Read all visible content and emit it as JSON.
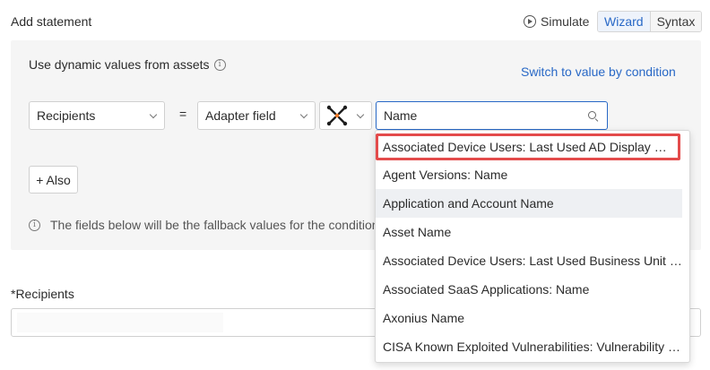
{
  "header": {
    "title": "Add statement",
    "simulate_label": "Simulate",
    "modes": [
      "Wizard",
      "Syntax"
    ],
    "active_mode": "Wizard"
  },
  "panel": {
    "dynamic_label": "Use dynamic values from assets",
    "switch_link": "Switch to value by condition",
    "field_select": "Recipients",
    "operator": "=",
    "source_select": "Adapter field",
    "adapter_icon": "axonius-x-logo-icon",
    "search_placeholder": "Name",
    "also_button": "+ Also",
    "fallback_text": "The fields below will be the fallback values for the condition"
  },
  "recipients": {
    "label": "*Recipients",
    "value": ""
  },
  "dropdown": {
    "items": [
      "Associated Device Users: Last Used AD Display Name",
      "Agent Versions: Name",
      "Application and Account Name",
      "Asset Name",
      "Associated Device Users: Last Used Business Unit Name",
      "Associated SaaS Applications: Name",
      "Axonius Name",
      "CISA Known Exploited Vulnerabilities: Vulnerability Name"
    ],
    "selected_index": 0,
    "hover_index": 2
  },
  "colors": {
    "accent": "#2868c6",
    "highlight_outline": "#e34b4b",
    "panel_bg": "#f5f5f5"
  }
}
